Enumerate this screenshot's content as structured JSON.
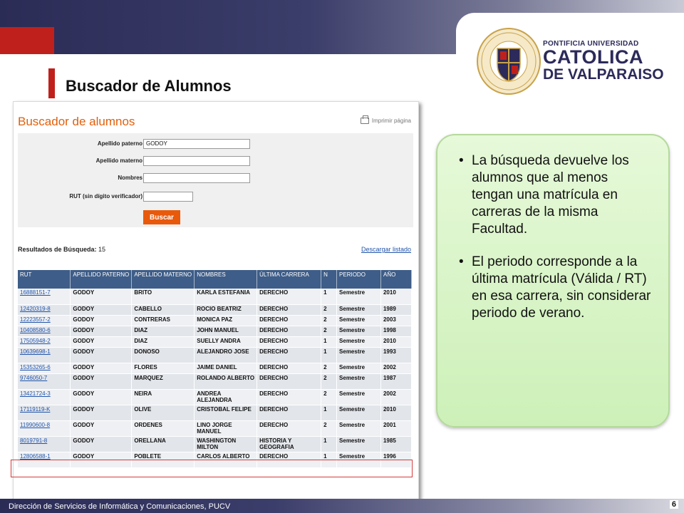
{
  "slide": {
    "title": "Buscador de Alumnos",
    "footer": "Dirección de Servicios de Informática y Comunicaciones, PUCV",
    "page_number": "6"
  },
  "logo": {
    "line1": "PONTIFICIA UNIVERSIDAD",
    "line2": "CATOLICA",
    "line3": "DE VALPARAISO"
  },
  "form": {
    "title": "Buscador de alumnos",
    "print_label": "Imprimir página",
    "fields": [
      {
        "label": "Apellido paterno",
        "value": ""
      },
      {
        "label": "Apellido materno",
        "value": ""
      },
      {
        "label": "Nombres",
        "value": ""
      },
      {
        "label": "RUT (sin dígito verificador)",
        "value": ""
      }
    ],
    "apellido_paterno_value": "GODOY",
    "search_button": "Buscar"
  },
  "results": {
    "label": "Resultados de Búsqueda:",
    "count": "15",
    "download_label": "Descargar listado",
    "columns": [
      "RUT",
      "APELLIDO PATERNO",
      "APELLIDO MATERNO",
      "NOMBRES",
      "ÚLTIMA CARRERA",
      "N",
      "PERIODO",
      "AÑO"
    ],
    "rows": [
      [
        "16888151-7",
        "GODOY",
        "BRITO",
        "KARLA ESTEFANIA",
        "DERECHO",
        "1",
        "Semestre",
        "2010"
      ],
      [
        "12420319-8",
        "GODOY",
        "CABELLO",
        "ROCIO BEATRIZ",
        "DERECHO",
        "2",
        "Semestre",
        "1989"
      ],
      [
        "12223557-2",
        "GODOY",
        "CONTRERAS",
        "MONICA PAZ",
        "DERECHO",
        "2",
        "Semestre",
        "2003"
      ],
      [
        "10408580-6",
        "GODOY",
        "DIAZ",
        "JOHN MANUEL",
        "DERECHO",
        "2",
        "Semestre",
        "1998"
      ],
      [
        "17505948-2",
        "GODOY",
        "DIAZ",
        "SUELLY ANDRA",
        "DERECHO",
        "1",
        "Semestre",
        "2010"
      ],
      [
        "10639698-1",
        "GODOY",
        "DONOSO",
        "ALEJANDRO JOSE",
        "DERECHO",
        "1",
        "Semestre",
        "1993"
      ],
      [
        "15353265-6",
        "GODOY",
        "FLORES",
        "JAIME DANIEL",
        "DERECHO",
        "2",
        "Semestre",
        "2002"
      ],
      [
        "9746050-7",
        "GODOY",
        "MARQUEZ",
        "ROLANDO ALBERTO",
        "DERECHO",
        "2",
        "Semestre",
        "1987"
      ],
      [
        "13421724-3",
        "GODOY",
        "NEIRA",
        "ANDREA ALEJANDRA",
        "DERECHO",
        "2",
        "Semestre",
        "2002"
      ],
      [
        "17119119-K",
        "GODOY",
        "OLIVE",
        "CRISTOBAL FELIPE",
        "DERECHO",
        "1",
        "Semestre",
        "2010"
      ],
      [
        "11990600-8",
        "GODOY",
        "ORDENES",
        "LINO JORGE MANUEL",
        "DERECHO",
        "2",
        "Semestre",
        "2001"
      ],
      [
        "8019791-8",
        "GODOY",
        "ORELLANA",
        "WASHINGTON MILTON",
        "HISTORIA Y GEOGRAFIA",
        "1",
        "Semestre",
        "1985"
      ],
      [
        "12806588-1",
        "GODOY",
        "POBLETE",
        "CARLOS ALBERTO",
        "DERECHO",
        "1",
        "Semestre",
        "1996"
      ]
    ]
  },
  "callout": {
    "bullets": [
      "La búsqueda devuelve los alumnos que al menos tengan una matrícula en carreras de la misma Facultad.",
      "El periodo corresponde a la última matrícula (Válida / RT) en esa carrera, sin considerar periodo de verano."
    ]
  },
  "colors": {
    "accent_red": "#c0201c",
    "header_navy": "#2b2c56",
    "table_header": "#3e5d88",
    "button_orange": "#e8590c",
    "callout_green": "#cdf0b8"
  }
}
